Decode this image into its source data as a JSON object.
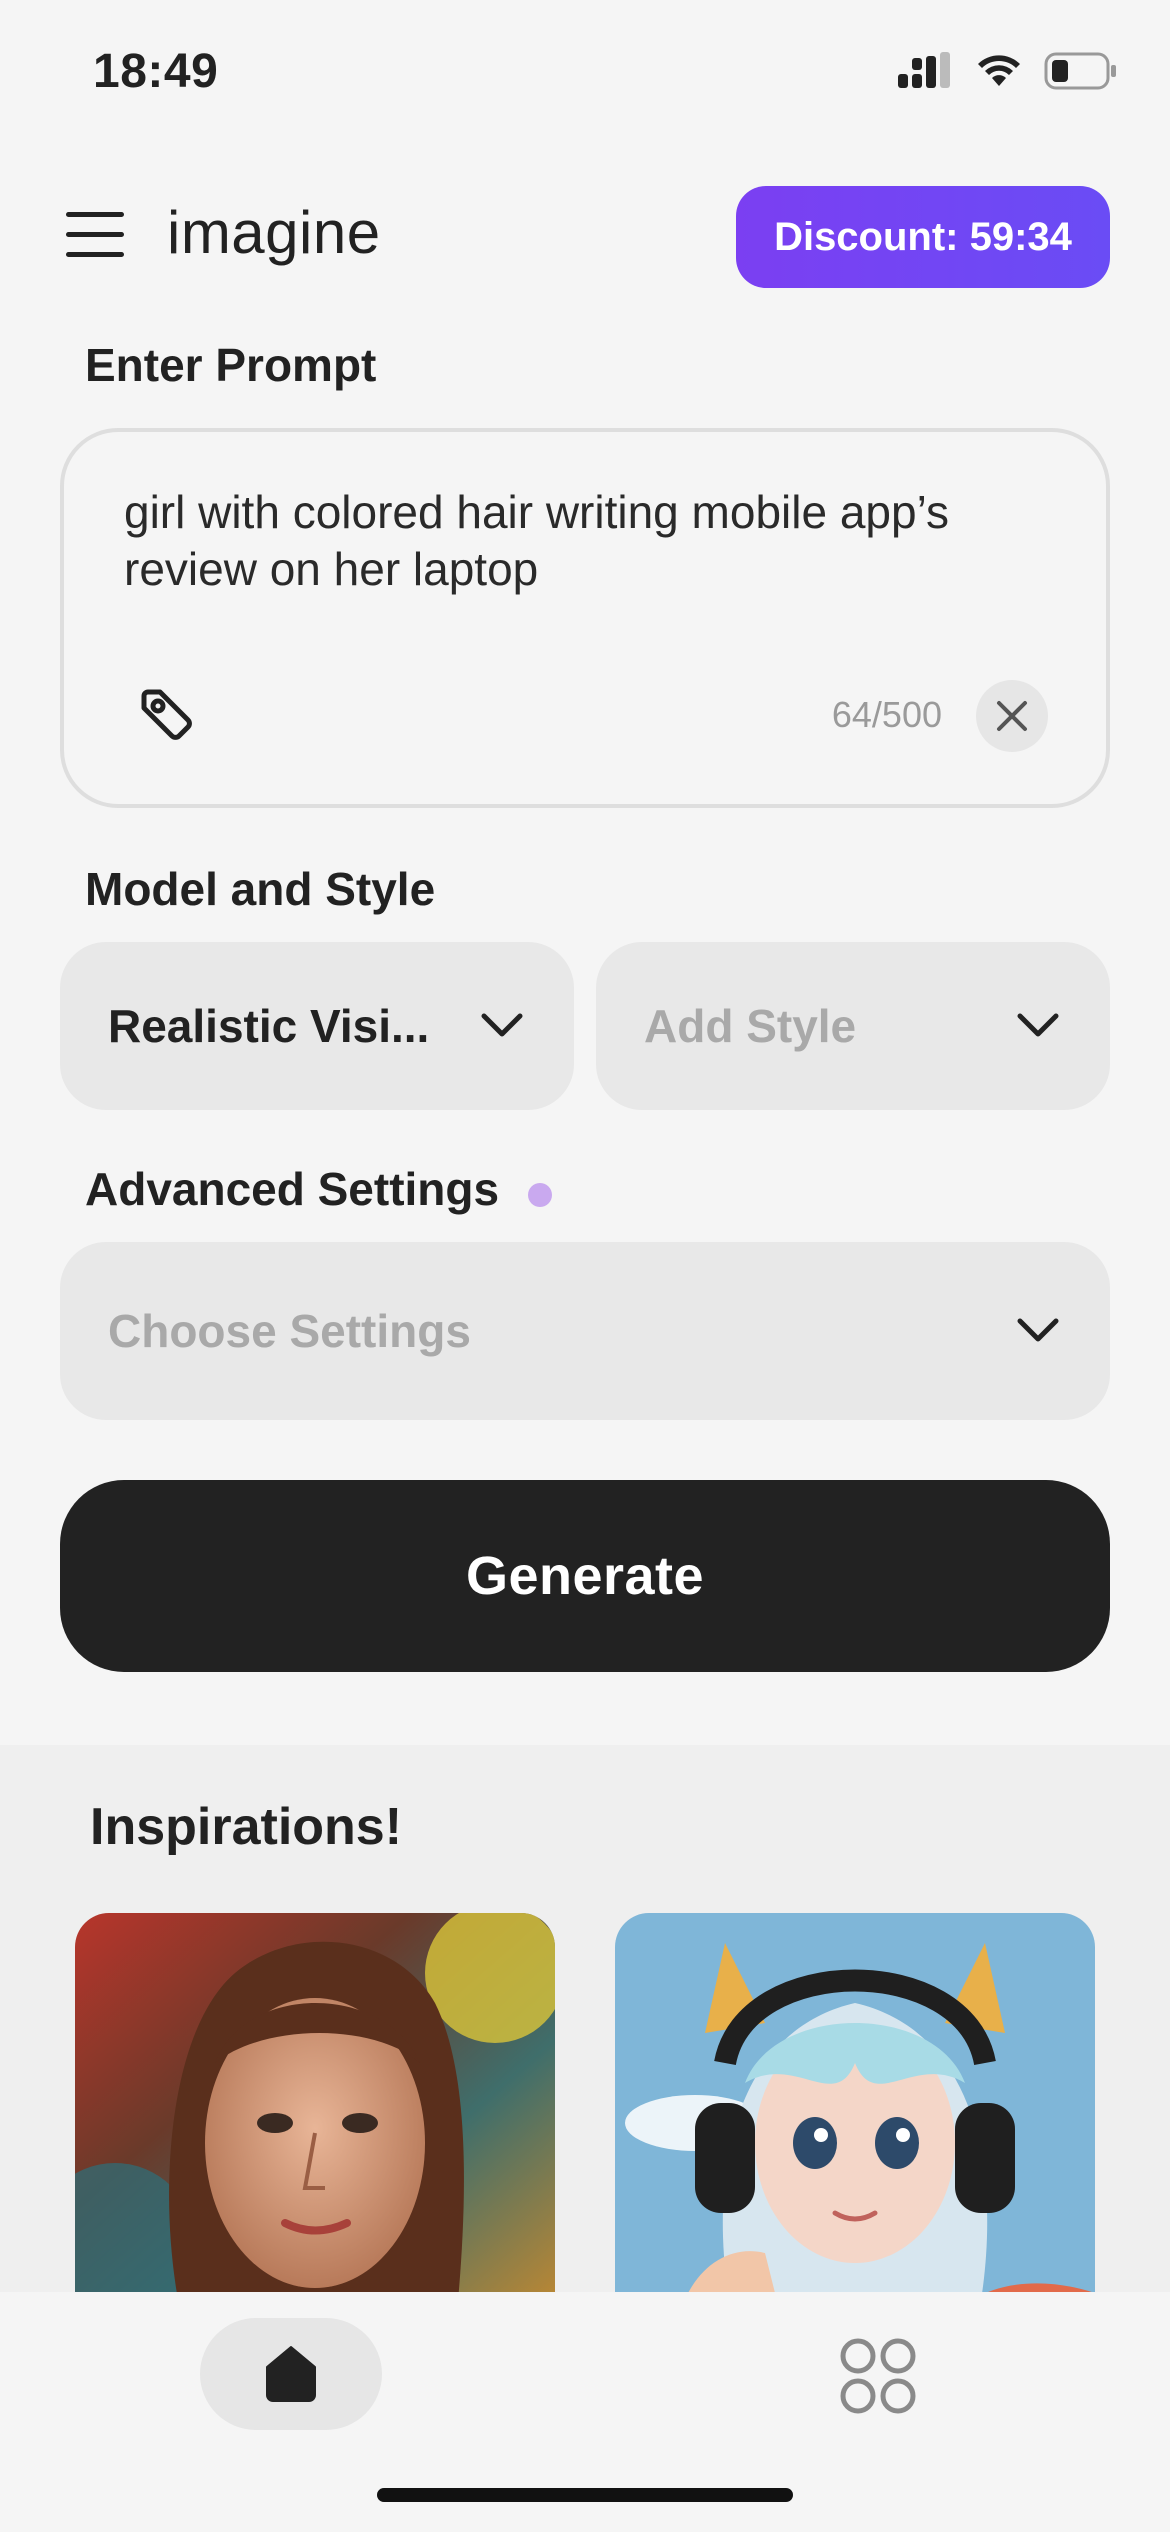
{
  "status_bar": {
    "time": "18:49"
  },
  "header": {
    "app_title": "imagine",
    "discount_label": "Discount: 59:34"
  },
  "prompt": {
    "section_label": "Enter Prompt",
    "text": "girl with colored hair writing mobile app’s review on her laptop",
    "counter": "64/500"
  },
  "model_style": {
    "section_label": "Model and Style",
    "model_value": "Realistic Visi...",
    "style_placeholder": "Add Style"
  },
  "advanced": {
    "section_label": "Advanced Settings",
    "placeholder": "Choose Settings"
  },
  "generate_label": "Generate",
  "inspirations": {
    "title": "Inspirations!"
  },
  "colors": {
    "accent": "#7b3ff2",
    "dark_button": "#222222",
    "dot": "#c9a9ef"
  }
}
